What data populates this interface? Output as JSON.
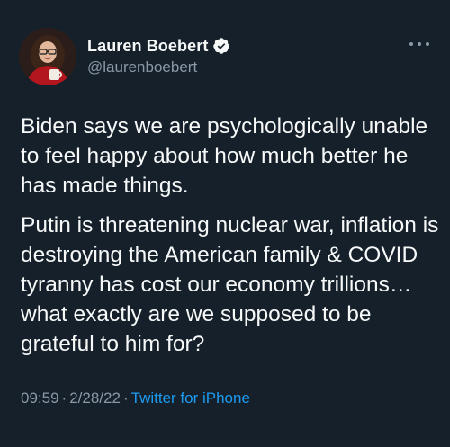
{
  "author": {
    "display_name": "Lauren Boebert",
    "handle": "@laurenboebert",
    "verified_icon": "verified-badge-icon",
    "avatar_icon": "profile-photo"
  },
  "tweet": {
    "paragraphs": [
      "Biden says we are psychologically unable to feel happy about how much better he has made things.",
      "Putin is threatening nuclear war, inflation is destroying the American family & COVID tyranny has cost our economy trillions… what exactly are we supposed to be grateful to him for?"
    ]
  },
  "meta": {
    "time": "09:59",
    "date": "2/28/22",
    "separator": "·",
    "source": "Twitter for iPhone"
  },
  "colors": {
    "background": "#15202b",
    "text": "#f7f9f9",
    "secondary": "#8b98a5",
    "accent": "#1d9bf0"
  }
}
